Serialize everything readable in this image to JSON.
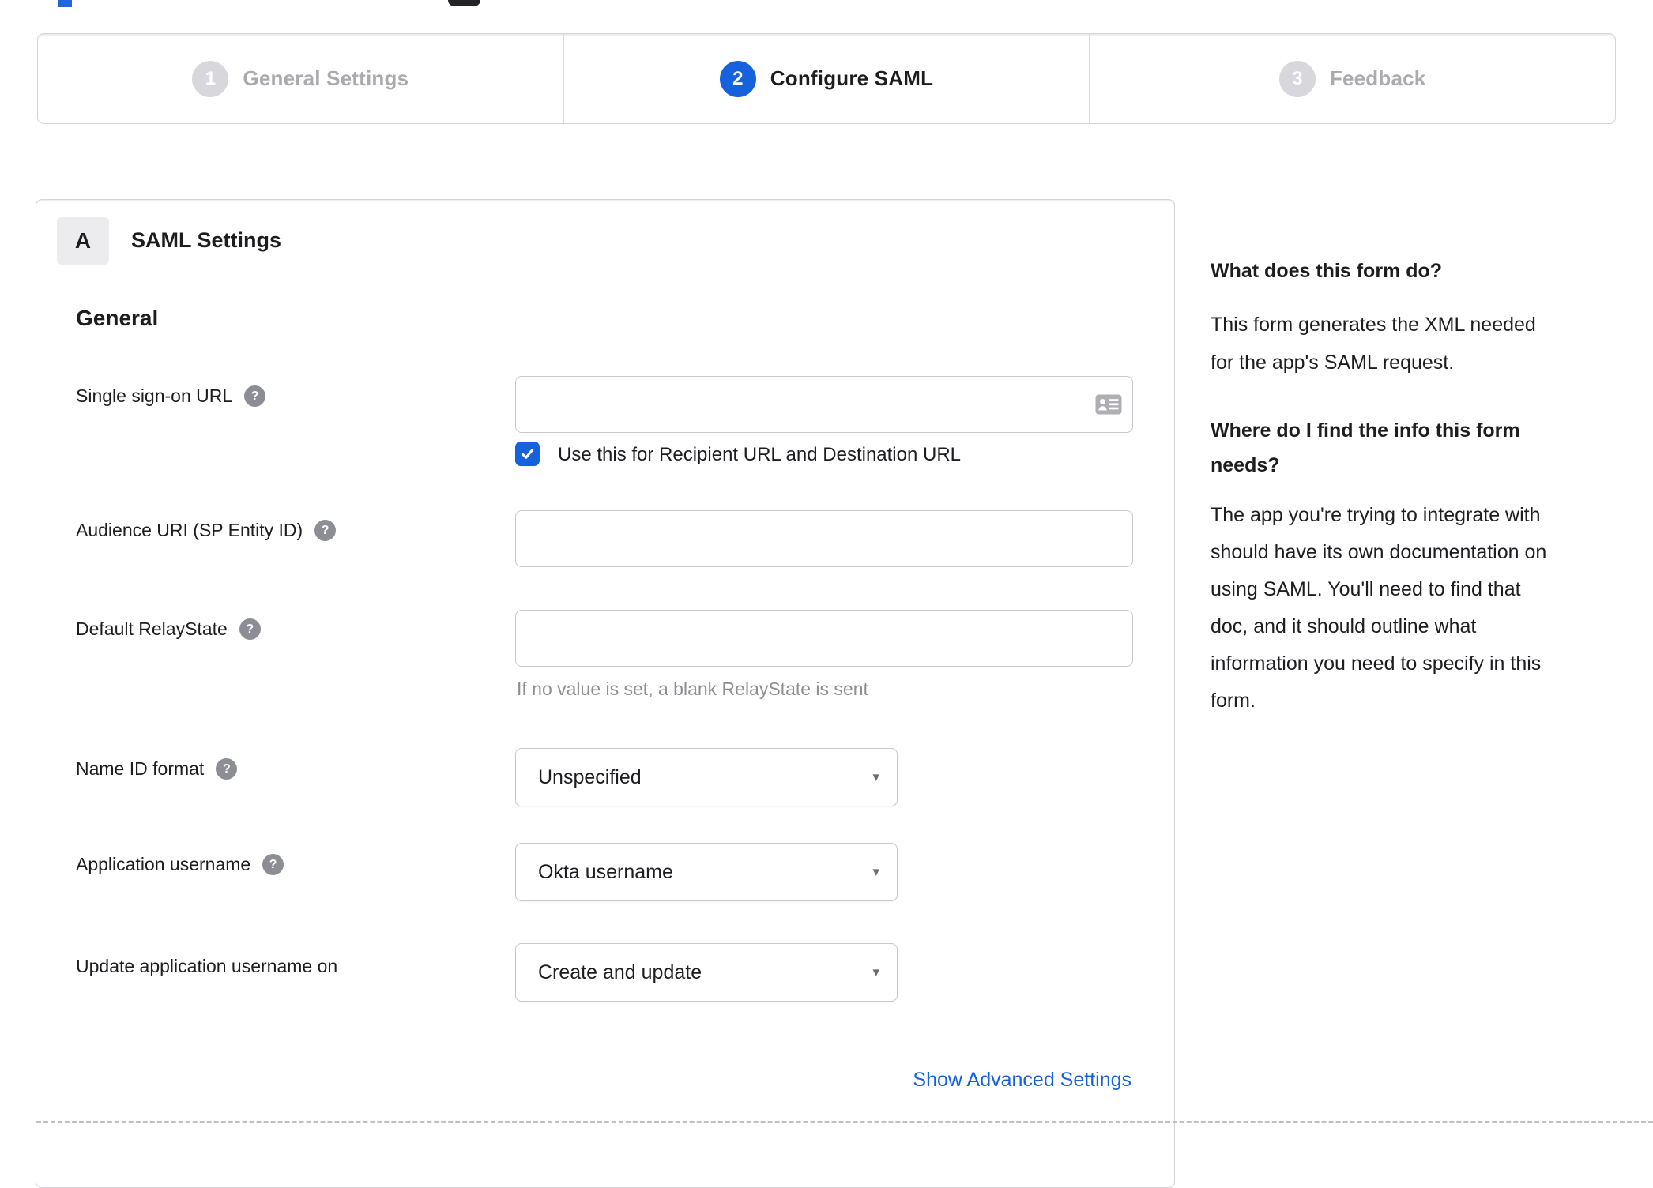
{
  "colors": {
    "accent": "#1662dd",
    "link": "#1661de",
    "inactive_step": "#a9a9b0",
    "text": "#1d1d21",
    "hint": "#8d8d94",
    "border": "#d4d4d9"
  },
  "stepper": {
    "steps": [
      {
        "num": "1",
        "label": "General Settings",
        "active": false
      },
      {
        "num": "2",
        "label": "Configure SAML",
        "active": true
      },
      {
        "num": "3",
        "label": "Feedback",
        "active": false
      }
    ]
  },
  "panel": {
    "badge": "A",
    "title": "SAML Settings",
    "section": "General",
    "fields": {
      "sso": {
        "label": "Single sign-on URL",
        "value": "",
        "checkbox_label": "Use this for Recipient URL and Destination URL",
        "checked": true
      },
      "audience": {
        "label": "Audience URI (SP Entity ID)",
        "value": ""
      },
      "relay": {
        "label": "Default RelayState",
        "value": "",
        "hint": "If no value is set, a blank RelayState is sent"
      },
      "name_id": {
        "label": "Name ID format",
        "value": "Unspecified"
      },
      "app_username": {
        "label": "Application username",
        "value": "Okta username"
      },
      "update_username": {
        "label": "Update application username on",
        "value": "Create and update"
      }
    },
    "advanced_link": "Show Advanced Settings"
  },
  "sidebar": {
    "q1": "What does this form do?",
    "a1": "This form generates the XML needed\nfor the app's SAML request.",
    "q2": "Where do I find the info this form\nneeds?",
    "a2": "The app you're trying to integrate with\nshould have its own documentation on\nusing SAML. You'll need to find that\ndoc, and it should outline what\ninformation you need to specify in this\nform."
  },
  "icons": {
    "help": "?",
    "caret": "▾"
  }
}
